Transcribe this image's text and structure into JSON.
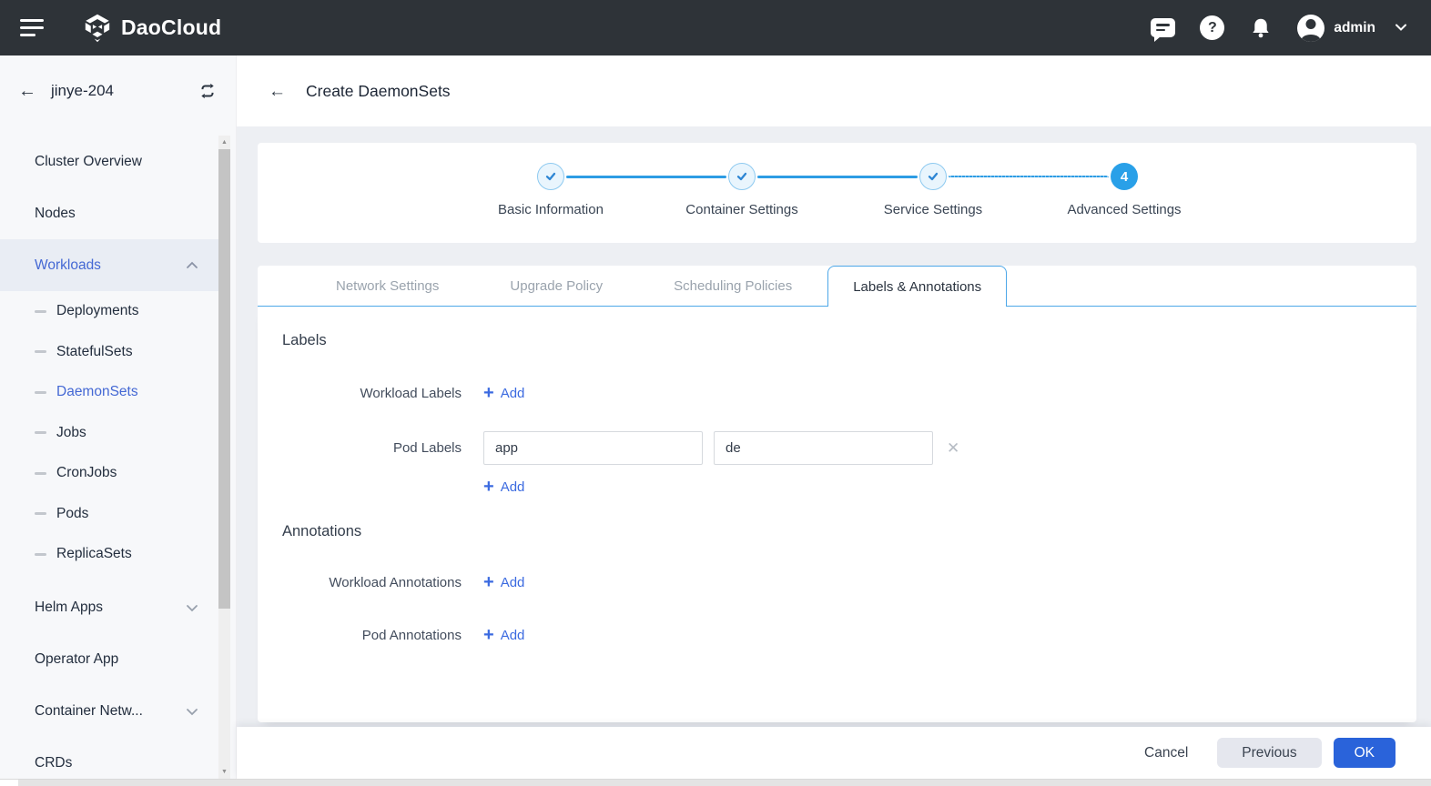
{
  "colors": {
    "topbar_bg": "#2e3338",
    "accent_blue": "#3b6ae0",
    "sidebar_active_blue": "#4468d4",
    "stepper_blue": "#2d9ce4",
    "tab_border_blue": "#4da7e8",
    "ok_button_bg": "#2a63da"
  },
  "topbar": {
    "brand": "DaoCloud",
    "user": "admin"
  },
  "sidebar": {
    "cluster_name": "jinye-204",
    "items": [
      {
        "label": "Cluster Overview"
      },
      {
        "label": "Nodes"
      },
      {
        "label": "Workloads"
      },
      {
        "label": "Deployments"
      },
      {
        "label": "StatefulSets"
      },
      {
        "label": "DaemonSets"
      },
      {
        "label": "Jobs"
      },
      {
        "label": "CronJobs"
      },
      {
        "label": "Pods"
      },
      {
        "label": "ReplicaSets"
      },
      {
        "label": "Helm Apps"
      },
      {
        "label": "Operator App"
      },
      {
        "label": "Container Netw..."
      },
      {
        "label": "CRDs"
      }
    ]
  },
  "page": {
    "title": "Create DaemonSets",
    "stepper": {
      "steps": [
        {
          "label": "Basic Information",
          "state": "done"
        },
        {
          "label": "Container Settings",
          "state": "done"
        },
        {
          "label": "Service Settings",
          "state": "done"
        },
        {
          "label": "Advanced Settings",
          "state": "current",
          "number": "4"
        }
      ]
    },
    "tabs": [
      {
        "label": "Network Settings",
        "active": false
      },
      {
        "label": "Upgrade Policy",
        "active": false
      },
      {
        "label": "Scheduling Policies",
        "active": false
      },
      {
        "label": "Labels & Annotations",
        "active": true
      }
    ],
    "labels_section": {
      "heading": "Labels",
      "workload_labels_label": "Workload Labels",
      "pod_labels_label": "Pod Labels",
      "pod_label_key": "app",
      "pod_label_value": "de",
      "add_label": "Add"
    },
    "annotations_section": {
      "heading": "Annotations",
      "workload_annotations_label": "Workload Annotations",
      "pod_annotations_label": "Pod Annotations",
      "add_label": "Add"
    },
    "footer": {
      "cancel": "Cancel",
      "previous": "Previous",
      "ok": "OK"
    }
  },
  "icons": {
    "back_arrow": "←",
    "close": "✕",
    "plus": "+",
    "question_mark": "?",
    "scroll_up": "▲",
    "scroll_down": "▼"
  }
}
